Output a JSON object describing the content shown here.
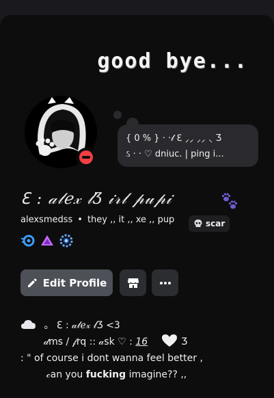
{
  "banner": {
    "title": "good bye..."
  },
  "status": {
    "line1": "{ 0 % } · ·𝓁 ℇ ⸝⸝ ⸝⸝ ⸜ Ʒ",
    "line2": "ઽ · · ♡ dniuc. | ping i..."
  },
  "profile": {
    "display_name": "ℇ : 𝒶𝓁ℯ𝓍 𝓁Ʒ 𝒾𝓇𝓁 𝓅𝓊𝓅𝒾",
    "username": "alexsmedss",
    "pronouns": "they ,, it ,, xe ,, pup",
    "tag": "scar"
  },
  "buttons": {
    "edit_profile": "Edit Profile"
  },
  "icons": {
    "status": "do-not-disturb-icon",
    "paw": "paw-prints-icon",
    "tag": "skull-icon",
    "badge1": "speed-badge-icon",
    "badge2": "triangle-badge-icon",
    "badge3": "gear-badge-icon",
    "edit": "pencil-icon",
    "shop": "shop-icon",
    "more": "more-icon"
  },
  "bio": {
    "line1": "。 ℇ : 𝒶𝓁ℯ𝓍 𝓁Ʒ <3",
    "line2a": "𝒹ms / 𝒻rq :: 𝒶sk ♡ : ",
    "line2_num": "16",
    "line2b": " Ʒ",
    "line3": ": \" of course i dont wanna feel better ,",
    "line4a": "𝒸an you ",
    "line4_bold": "fucking",
    "line4b": " imagine?? ,,"
  },
  "colors": {
    "background": "#0d0d0d",
    "bubble": "#2a2a2e",
    "edit_button": "#4e5058",
    "dnd": "#f23f43",
    "badge_blue": "#3ba0ff",
    "badge_purple": "#c66bff"
  }
}
